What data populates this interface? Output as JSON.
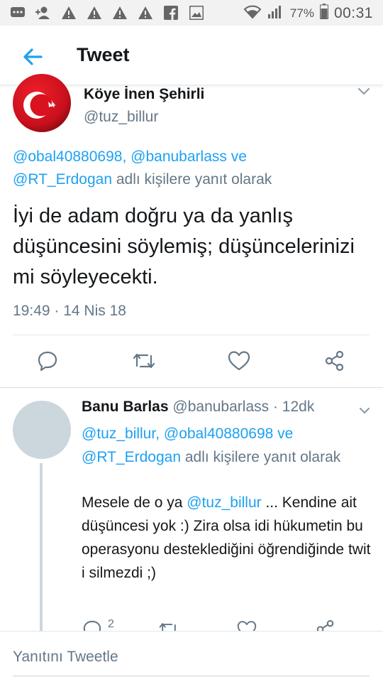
{
  "status_bar": {
    "battery_percent": "77%",
    "time": "00:31"
  },
  "appbar": {
    "title": "Tweet"
  },
  "main_tweet": {
    "name": "Köye İnen Şehirli",
    "handle": "@tuz_billur",
    "reply_mentions": [
      "@obal40880698",
      "@banubarlass",
      "@RT_Erdogan"
    ],
    "reply_sep_1": ", ",
    "reply_sep_2": " ve",
    "reply_suffix": " adlı kişilere yanıt olarak",
    "text": "İyi de adam doğru ya da yanlış düşüncesini söylemiş; düşüncelerinizi mi söyleyecekti.",
    "timestamp": "19:49 · 14 Nis 18"
  },
  "reply_tweet": {
    "name": "Banu Barlas",
    "handle": "@banubarlass",
    "time_ago": " · 12dk",
    "reply_mentions": [
      "@tuz_billur",
      "@obal40880698",
      "@RT_Erdogan"
    ],
    "reply_sep_1": ", ",
    "reply_sep_2": " ve",
    "reply_suffix": " adlı kişilere yanıt olarak",
    "text_before": "Mesele de o ya ",
    "text_mention": "@tuz_billur",
    "text_after": " ... Kendine ait düşüncesi yok :) Zira olsa idi hükumetin bu operasyonu desteklediğini öğrendiğinde twit i silmezdi ;)",
    "reply_count": "2"
  },
  "compose": {
    "placeholder": "Yanıtını Tweetle"
  },
  "colors": {
    "accent": "#1da1f2",
    "secondary_text": "#657786",
    "primary_text": "#14171a"
  }
}
